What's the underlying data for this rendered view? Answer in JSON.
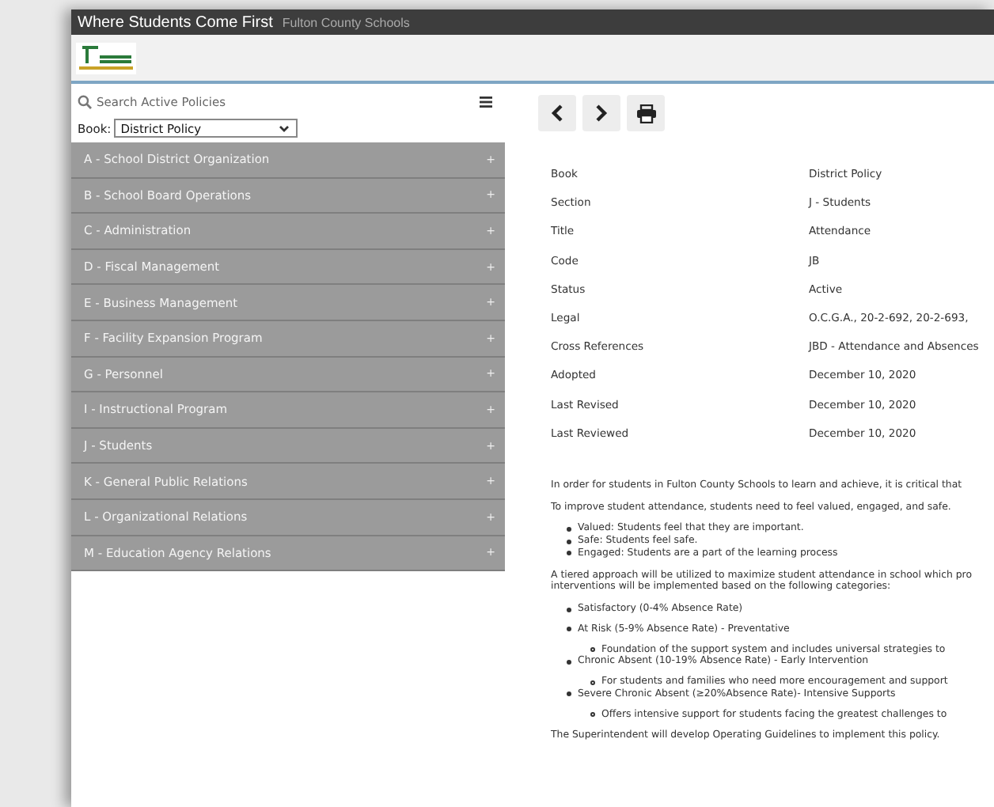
{
  "window": {
    "title": "Where Students Come First",
    "subtitle": "Fulton County Schools"
  },
  "sidebar": {
    "search": {
      "placeholder": "Search Active Policies"
    },
    "book": {
      "label": "Book:",
      "value": "District Policy"
    },
    "items": [
      {
        "label": "A - School District Organization",
        "toggle": "+"
      },
      {
        "label": "B - School Board Operations",
        "toggle": "+"
      },
      {
        "label": "C - Administration",
        "toggle": "+"
      },
      {
        "label": "D - Fiscal Management",
        "toggle": "+"
      },
      {
        "label": "E - Business Management",
        "toggle": "+"
      },
      {
        "label": "F - Facility Expansion Program",
        "toggle": "+"
      },
      {
        "label": "G - Personnel",
        "toggle": "+"
      },
      {
        "label": "I - Instructional Program",
        "toggle": "+"
      },
      {
        "label": "J - Students",
        "toggle": "+"
      },
      {
        "label": "K - General Public Relations",
        "toggle": "+"
      },
      {
        "label": "L - Organizational Relations",
        "toggle": "+"
      },
      {
        "label": "M - Education Agency Relations",
        "toggle": "+"
      }
    ]
  },
  "details": [
    {
      "label": "Book",
      "value": "District Policy"
    },
    {
      "label": "Section",
      "value": "J - Students"
    },
    {
      "label": "Title",
      "value": "Attendance"
    },
    {
      "label": "Code",
      "value": "JB"
    },
    {
      "label": "Status",
      "value": "Active"
    },
    {
      "label": "Legal",
      "value": "O.C.G.A., 20-2-692, 20-2-693,"
    },
    {
      "label": "Cross References",
      "value": "JBD - Attendance and Absences"
    },
    {
      "label": "Adopted",
      "value": "December 10, 2020"
    },
    {
      "label": "Last Revised",
      "value": "December 10, 2020"
    },
    {
      "label": "Last Reviewed",
      "value": "December 10, 2020"
    }
  ],
  "body": [
    {
      "kind": "paragraph",
      "text": "In order for students in Fulton County Schools to learn and achieve, it is critical that"
    },
    {
      "kind": "paragraph",
      "text": "To improve student attendance, students need to feel valued, engaged, and safe."
    },
    {
      "kind": "list",
      "items": [
        {
          "text": "Valued: Students feel that they are important."
        },
        {
          "text": "Safe: Students feel safe."
        },
        {
          "text": "Engaged: Students are a part of the learning process"
        }
      ]
    },
    {
      "kind": "paragraph",
      "text": "A tiered approach will be utilized to maximize student attendance in school which pro interventions will be implemented based on the following categories:"
    },
    {
      "kind": "list",
      "spaced": true,
      "items": [
        {
          "text": "Satisfactory (0-4% Absence Rate)"
        },
        {
          "text": "At Risk (5-9% Absence Rate) - Preventative",
          "children": [
            {
              "text": "Foundation of the support system and includes universal strategies to"
            }
          ]
        },
        {
          "text": "Chronic Absent (10-19% Absence Rate) - Early Intervention",
          "children": [
            {
              "text": "For students and families who need more encouragement and support"
            }
          ]
        },
        {
          "text": "Severe Chronic Absent (≥20%Absence Rate)- Intensive Supports",
          "children": [
            {
              "text": "Offers intensive support for students facing the greatest challenges to"
            }
          ]
        }
      ]
    },
    {
      "kind": "paragraph",
      "text": "The Superintendent will develop Operating Guidelines to implement this policy."
    }
  ]
}
